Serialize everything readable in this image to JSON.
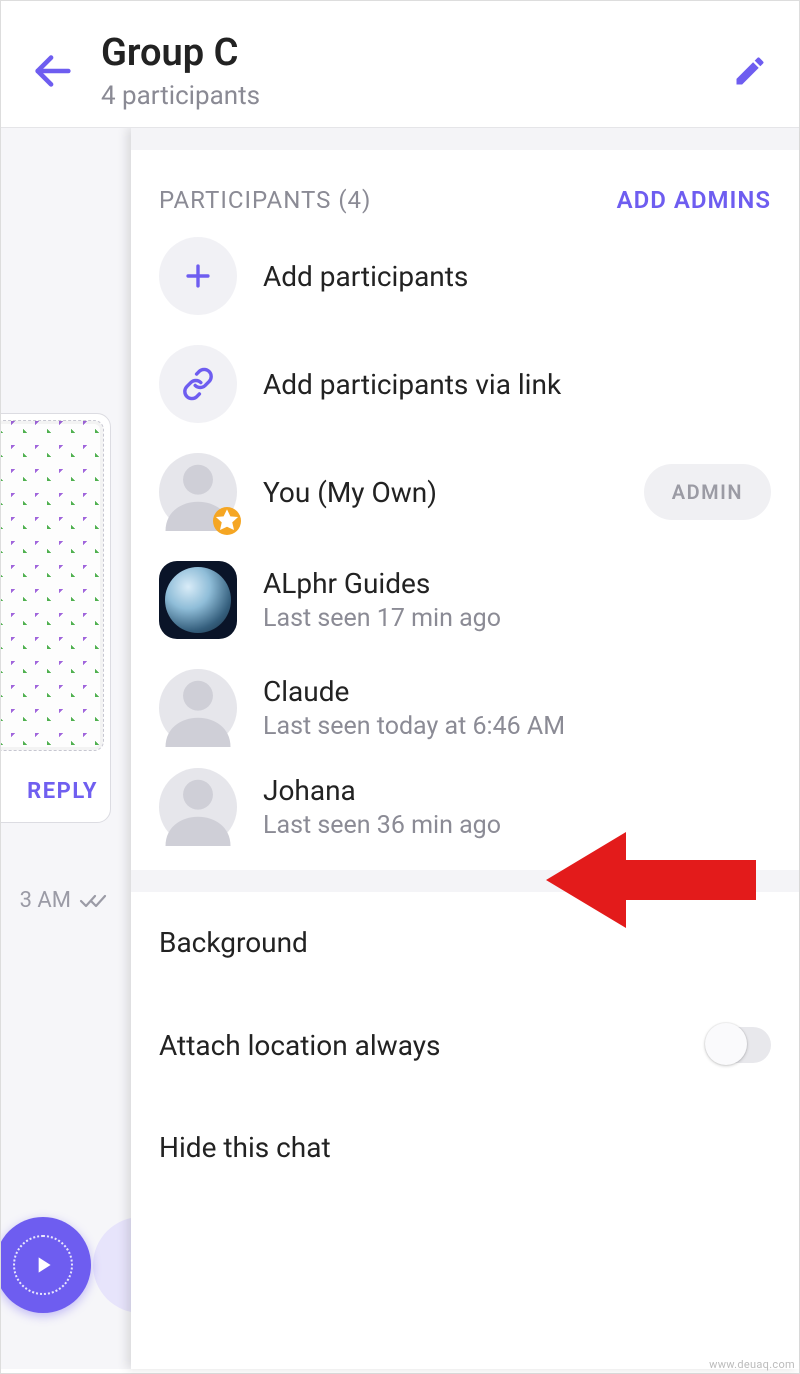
{
  "header": {
    "title": "Group C",
    "subtitle": "4 participants"
  },
  "left": {
    "replyLabel": "REPLY",
    "timestampFragment": "3 AM"
  },
  "panel": {
    "participantsHeader": "PARTICIPANTS (4)",
    "addAdminsLabel": "ADD ADMINS",
    "addParticipantsLabel": "Add participants",
    "addViaLinkLabel": "Add participants via link",
    "adminBadge": "ADMIN",
    "members": [
      {
        "name": "You (My Own)",
        "sub": ""
      },
      {
        "name": "ALphr Guides",
        "sub": "Last seen 17 min ago"
      },
      {
        "name": "Claude",
        "sub": "Last seen today at 6:46 AM"
      },
      {
        "name": "Johana",
        "sub": "Last seen 36 min ago"
      }
    ],
    "settings": {
      "backgroundLabel": "Background",
      "attachLocationLabel": "Attach location always",
      "hideChatLabel": "Hide this chat"
    }
  },
  "watermark": "www.deuaq.com"
}
